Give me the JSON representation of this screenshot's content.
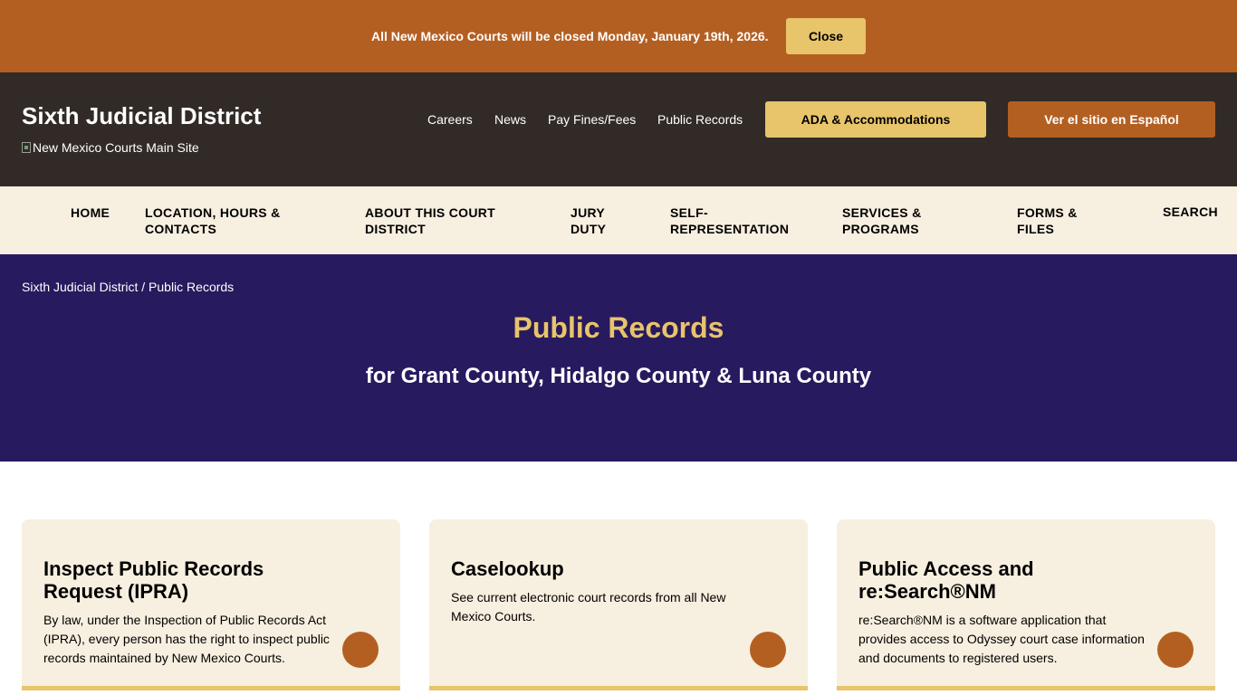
{
  "alert": {
    "message": "All New Mexico Courts will be closed Monday, January 19th, 2026.",
    "close_label": "Close"
  },
  "header": {
    "site_title": "Sixth Judicial District",
    "main_site_alt": "New Mexico Courts Main Site",
    "utility_nav": [
      "Careers",
      "News",
      "Pay Fines/Fees",
      "Public Records"
    ],
    "ada_label": "ADA & Accommodations",
    "spanish_label": "Ver el sitio en Español"
  },
  "main_nav": [
    {
      "line1": "HOME",
      "line2": ""
    },
    {
      "line1": "LOCATION, HOURS &",
      "line2": "CONTACTS"
    },
    {
      "line1": "ABOUT THIS COURT",
      "line2": "DISTRICT"
    },
    {
      "line1": "JURY",
      "line2": "DUTY"
    },
    {
      "line1": "SELF-",
      "line2": "REPRESENTATION"
    },
    {
      "line1": "SERVICES &",
      "line2": "PROGRAMS"
    },
    {
      "line1": "FORMS &",
      "line2": "FILES"
    },
    {
      "line1": "SEARCH",
      "line2": ""
    }
  ],
  "hero": {
    "breadcrumb": "Sixth Judicial District / Public Records",
    "title": "Public Records",
    "subtitle": "for Grant County, Hidalgo County & Luna County"
  },
  "cards": [
    {
      "title": "Inspect Public Records Request (IPRA)",
      "description": "By law, under the Inspection of Public Records Act (IPRA), every person has the right to inspect public records maintained by New Mexico Courts."
    },
    {
      "title": "Caselookup",
      "description": "See current electronic court records from all New Mexico Courts."
    },
    {
      "title": "Public Access and re:Search®NM",
      "description": "re:Search®NM is a software application that provides access to Odyssey court case information and documents to registered users."
    }
  ],
  "colors": {
    "accent_orange": "#b45f22",
    "accent_gold": "#e8c46a",
    "header_dark": "#322a27",
    "hero_purple": "#281a5f",
    "cream": "#f7efdf"
  }
}
